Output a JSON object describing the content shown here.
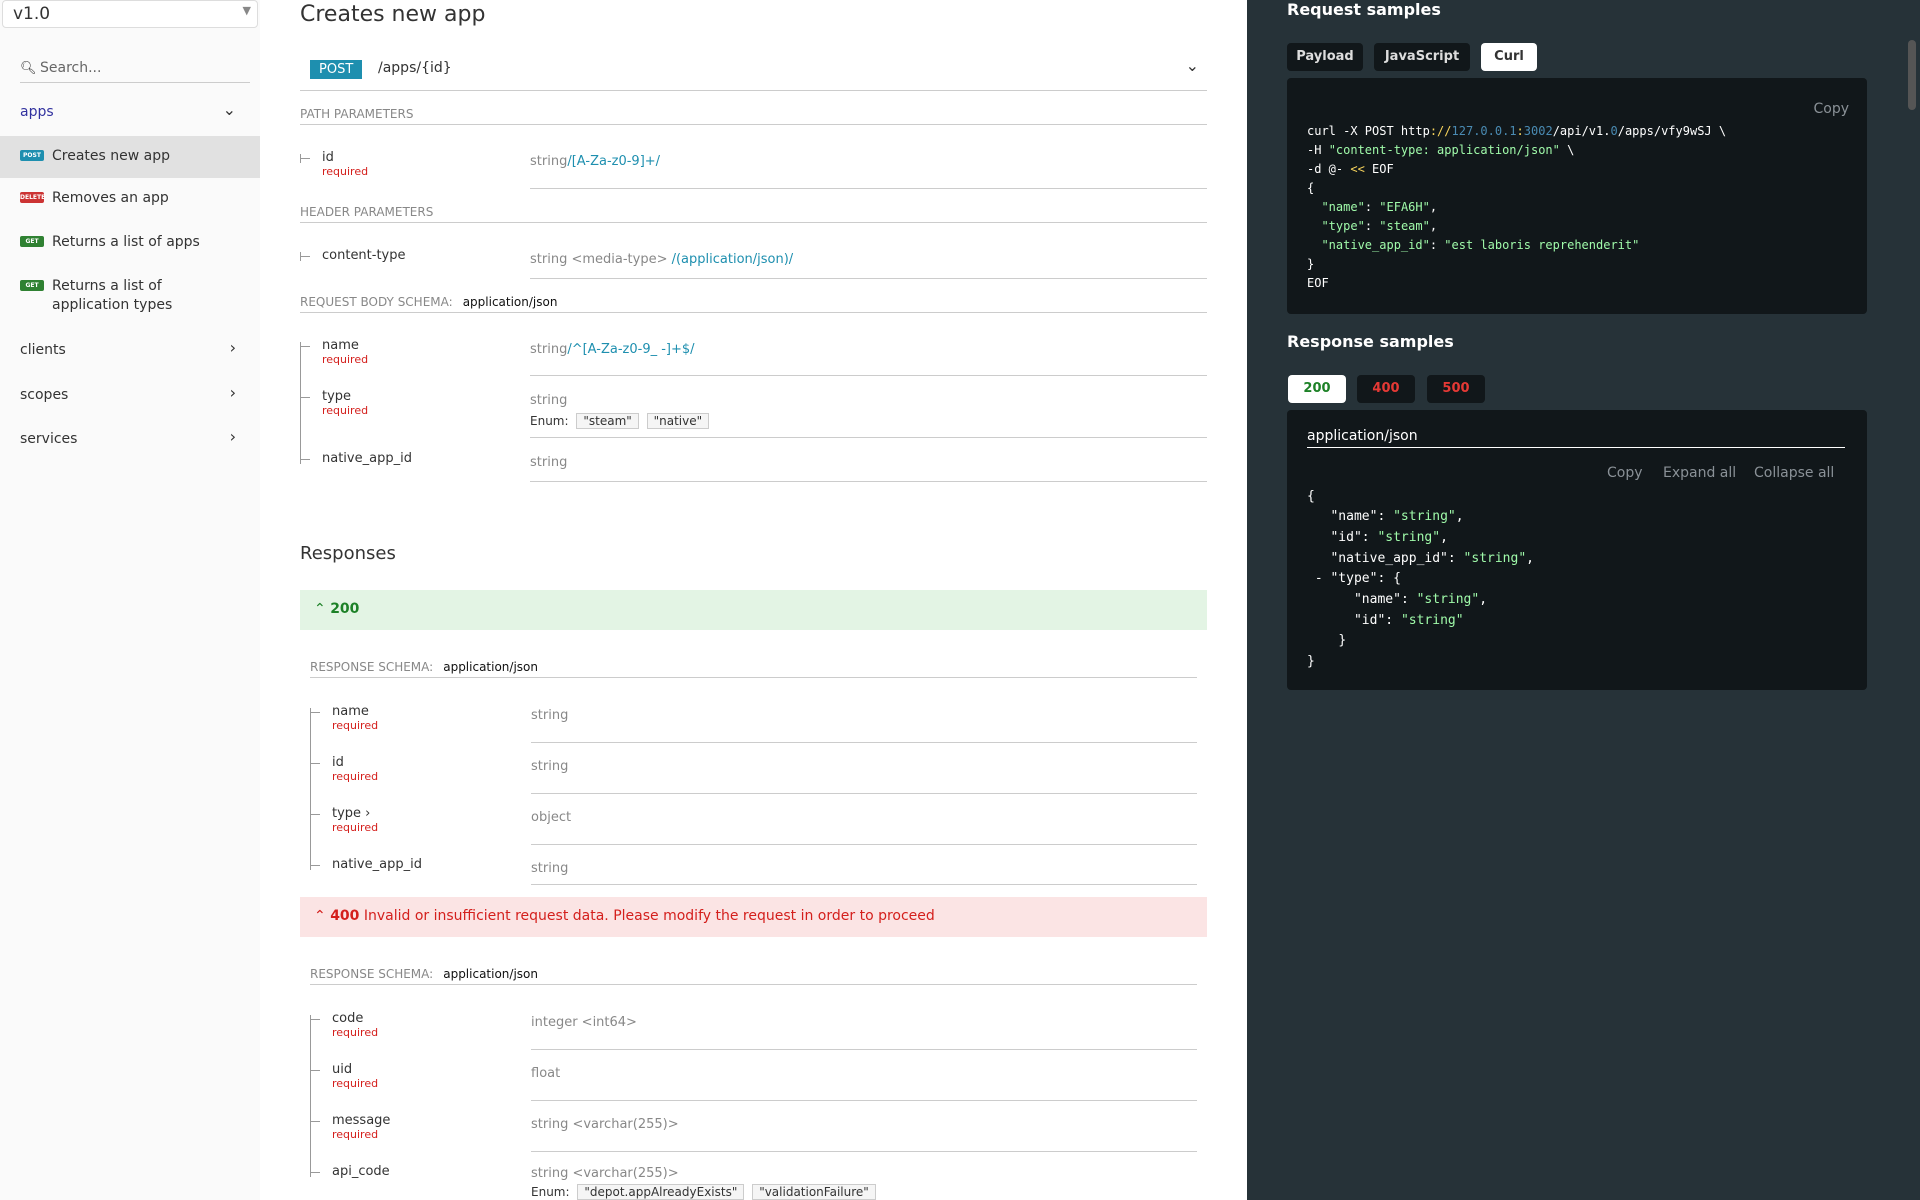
{
  "sidebar": {
    "version": "v1.0",
    "search_placeholder": "Search...",
    "groups": [
      {
        "label": "apps"
      },
      {
        "label": "clients"
      },
      {
        "label": "scopes"
      },
      {
        "label": "services"
      }
    ],
    "operations": [
      {
        "method": "POST",
        "label": "Creates new app"
      },
      {
        "method": "DELETE",
        "label": "Removes an app"
      },
      {
        "method": "GET",
        "label": "Returns a list of apps"
      },
      {
        "method": "GET",
        "label": "Returns a list of application types"
      }
    ]
  },
  "main": {
    "title": "Creates new app",
    "endpoint": {
      "method": "POST",
      "path": "/apps/{id}"
    },
    "path_params": {
      "title": "Path Parameters",
      "items": [
        {
          "name": "id",
          "required": "required",
          "type": "string",
          "pattern": "/[A-Za-z0-9]+/"
        }
      ]
    },
    "header_params": {
      "title": "Header Parameters",
      "items": [
        {
          "name": "content-type",
          "type": "string <media-type>",
          "pattern": "/(application/json)/"
        }
      ]
    },
    "request_body": {
      "title": "Request Body schema:",
      "content_type": "application/json",
      "items": [
        {
          "name": "name",
          "required": "required",
          "type": "string",
          "pattern": "/^[A-Za-z0-9_ -]+$/"
        },
        {
          "name": "type",
          "required": "required",
          "type": "string",
          "enum_label": "Enum:",
          "enum": [
            "\"steam\"",
            "\"native\""
          ]
        },
        {
          "name": "native_app_id",
          "type": "string"
        }
      ]
    },
    "responses_title": "Responses",
    "response_200": {
      "code": "200",
      "schema_title": "Response Schema:",
      "content_type": "application/json",
      "items": [
        {
          "name": "name",
          "required": "required",
          "type": "string"
        },
        {
          "name": "id",
          "required": "required",
          "type": "string"
        },
        {
          "name": "type ›",
          "required": "required",
          "type": "object"
        },
        {
          "name": "native_app_id",
          "type": "string"
        }
      ]
    },
    "response_400": {
      "code": "400",
      "description": "Invalid or insufficient request data. Please modify the request in order to proceed",
      "schema_title": "Response Schema:",
      "content_type": "application/json",
      "items": [
        {
          "name": "code",
          "required": "required",
          "type": "integer <int64>"
        },
        {
          "name": "uid",
          "required": "required",
          "type": "float"
        },
        {
          "name": "message",
          "required": "required",
          "type": "string <varchar(255)>"
        },
        {
          "name": "api_code",
          "type": "string <varchar(255)>",
          "enum_label": "Enum:",
          "enum": [
            "\"depot.appAlreadyExists\"",
            "\"validationFailure\""
          ]
        }
      ]
    }
  },
  "right": {
    "request_title": "Request samples",
    "request_tabs": [
      "Payload",
      "JavaScript",
      "Curl"
    ],
    "active_request_tab": "Curl",
    "copy_label": "Copy",
    "curl": {
      "l1_a": "curl -X POST http",
      "l1_b": "://",
      "l1_c": "127.0.0.1",
      "l1_d": ":",
      "l1_e": "3002",
      "l1_f": "/api/v1.",
      "l1_g": "0",
      "l1_h": "/apps/vfy9wSJ \\",
      "l2_a": "-H ",
      "l2_b": "\"content-type: application/json\"",
      "l2_c": " \\",
      "l3_a": "-d @- ",
      "l3_b": "<<",
      "l3_c": " EOF",
      "l4": "{",
      "l5_k": "\"name\"",
      "l5_v": "\"EFA6H\"",
      "l6_k": "\"type\"",
      "l6_v": "\"steam\"",
      "l7_k": "\"native_app_id\"",
      "l7_v": "\"est laboris reprehenderit\"",
      "l8": "}",
      "l9": "EOF"
    },
    "response_title": "Response samples",
    "response_tabs": [
      "200",
      "400",
      "500"
    ],
    "response_content_type": "application/json",
    "response_actions": [
      "Copy",
      "Expand all",
      "Collapse all"
    ],
    "json": {
      "open": "{",
      "k_name": "\"name\"",
      "v_name": "\"string\"",
      "k_id": "\"id\"",
      "v_id": "\"string\"",
      "k_native": "\"native_app_id\"",
      "v_native": "\"string\"",
      "k_type": "\"type\"",
      "k_tname": "\"name\"",
      "v_tname": "\"string\"",
      "k_tid": "\"id\"",
      "v_tid": "\"string\"",
      "close_inner": "}",
      "close": "}"
    },
    "colors": {
      "panel": "#263238",
      "code_bg": "#11171a",
      "ok": "#1d8127",
      "err": "#d41f1c"
    }
  }
}
